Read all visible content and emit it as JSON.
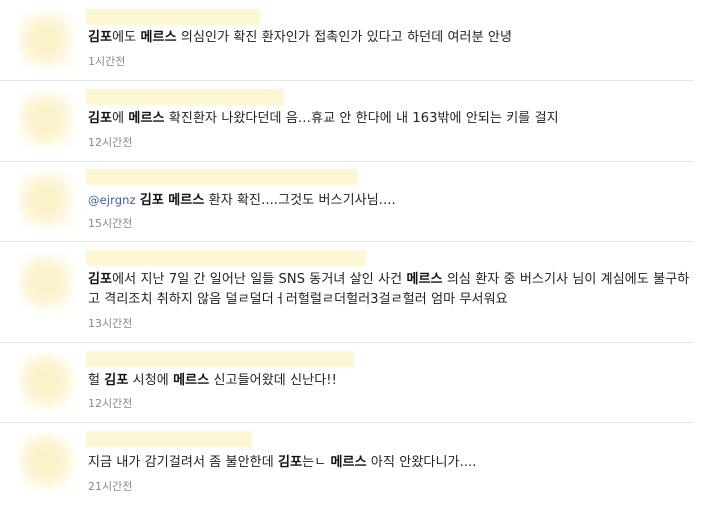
{
  "items": [
    {
      "segments": [
        {
          "t": "김포",
          "b": true
        },
        {
          "t": "에도 "
        },
        {
          "t": "메르스",
          "b": true
        },
        {
          "t": " 의심인가 확진 환자인가 접촉인가 있다고 하던데 여러분 안녕"
        }
      ],
      "time": "1시간전"
    },
    {
      "segments": [
        {
          "t": "김포",
          "b": true
        },
        {
          "t": "에 "
        },
        {
          "t": "메르스",
          "b": true
        },
        {
          "t": " 확진환자 나왔다던데 음…휴교 안 한다에 내 163밖에 안되는 키를 걸지"
        }
      ],
      "time": "12시간전"
    },
    {
      "segments": [
        {
          "t": "@ejrgnz",
          "m": true
        },
        {
          "t": " "
        },
        {
          "t": "김포",
          "b": true
        },
        {
          "t": " "
        },
        {
          "t": "메르스",
          "b": true
        },
        {
          "t": " 환자 확진....그것도 버스기사님...."
        }
      ],
      "time": "15시간전"
    },
    {
      "segments": [
        {
          "t": "김포",
          "b": true
        },
        {
          "t": "에서 지난 7일 간 일어난 일들 SNS 동거녀 살인 사건 "
        },
        {
          "t": "메르스",
          "b": true
        },
        {
          "t": " 의심 환자 중 버스기사 님이 계심에도 불구하고 격리조치 취하지 않음 덜ㄹ덜더ㅓ러헐럴ㄹ더헐러3걸ㄹ헐러 엄마 무서워요"
        }
      ],
      "time": "13시간전"
    },
    {
      "segments": [
        {
          "t": "헐 "
        },
        {
          "t": "김포",
          "b": true
        },
        {
          "t": " 시청에 "
        },
        {
          "t": "메르스",
          "b": true
        },
        {
          "t": " 신고들어왔데 신난다!!"
        }
      ],
      "time": "12시간전"
    },
    {
      "segments": [
        {
          "t": "지금 내가 감기걸려서 좀 불안한데 "
        },
        {
          "t": "김포",
          "b": true
        },
        {
          "t": "는ㄴ "
        },
        {
          "t": "메르스",
          "b": true
        },
        {
          "t": " 아직 안왔다니가...."
        }
      ],
      "time": "21시간전"
    }
  ]
}
